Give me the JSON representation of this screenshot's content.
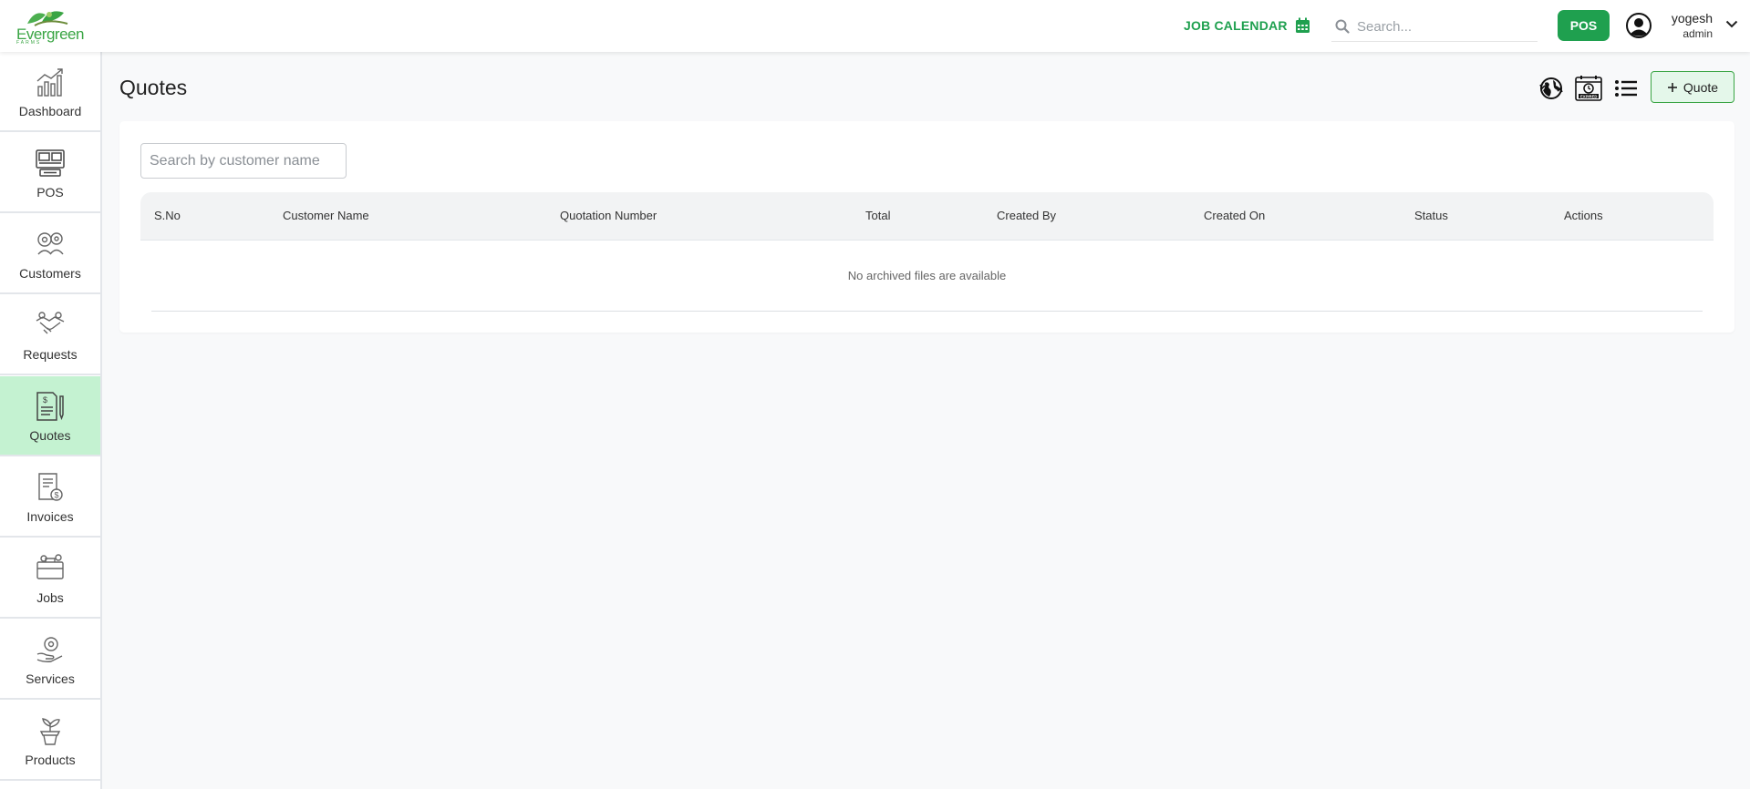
{
  "header": {
    "logo_text": "Evergreen",
    "logo_sub": "FARMS",
    "job_calendar_label": "JOB CALENDAR",
    "search_placeholder": "Search...",
    "pos_label": "POS",
    "user_name": "yogesh",
    "user_role": "admin"
  },
  "sidebar": {
    "items": [
      {
        "label": "Dashboard",
        "icon": "dashboard-chart-icon"
      },
      {
        "label": "POS",
        "icon": "pos-terminal-icon"
      },
      {
        "label": "Customers",
        "icon": "customers-gear-icon"
      },
      {
        "label": "Requests",
        "icon": "requests-handshake-icon"
      },
      {
        "label": "Quotes",
        "icon": "quotes-document-icon",
        "active": true
      },
      {
        "label": "Invoices",
        "icon": "invoices-document-icon"
      },
      {
        "label": "Jobs",
        "icon": "jobs-briefcase-icon"
      },
      {
        "label": "Services",
        "icon": "services-hand-icon"
      },
      {
        "label": "Products",
        "icon": "products-plant-icon"
      }
    ]
  },
  "main": {
    "title": "Quotes",
    "add_quote_label": "Quote",
    "customer_search_placeholder": "Search by customer name",
    "table": {
      "columns": [
        "S.No",
        "Customer Name",
        "Quotation Number",
        "Total",
        "Created By",
        "Created On",
        "Status",
        "Actions"
      ],
      "rows": [],
      "empty_message": "No archived files are available"
    }
  },
  "colors": {
    "brand_green": "#1fa04f",
    "active_nav_bg": "#c4f2d1",
    "add_button_bg": "#e4f7ea"
  }
}
